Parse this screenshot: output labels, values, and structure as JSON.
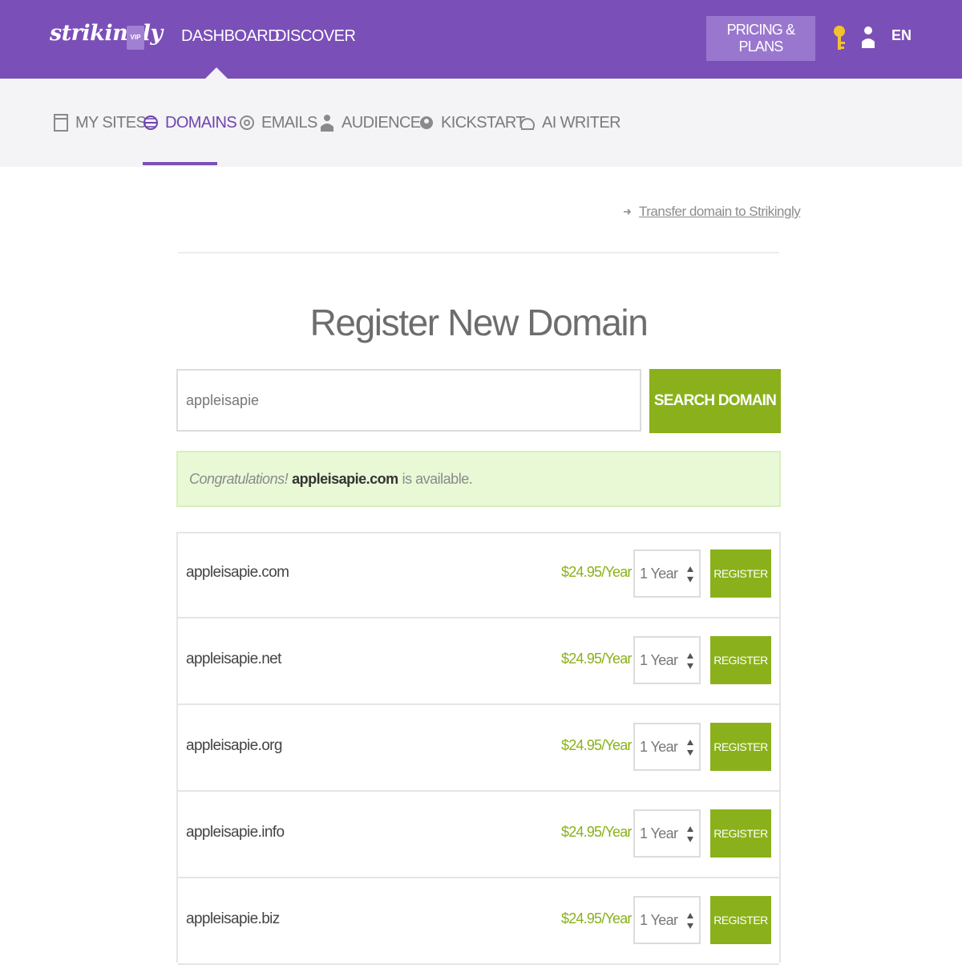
{
  "header": {
    "logo": "strikingly",
    "vip_badge": "VIP",
    "nav": [
      {
        "label": "DASHBOARD"
      },
      {
        "label": "DISCOVER"
      }
    ],
    "pricing_label": "PRICING & PLANS",
    "lang_label": "EN",
    "color": "#7b4fb8"
  },
  "subnav": {
    "items": [
      {
        "label": "MY SITES",
        "icon": "page-icon"
      },
      {
        "label": "DOMAINS",
        "icon": "globe-icon",
        "active": true
      },
      {
        "label": "EMAILS",
        "icon": "at-icon"
      },
      {
        "label": "AUDIENCE",
        "icon": "people-icon"
      },
      {
        "label": "KICKSTART",
        "icon": "rocket-icon"
      },
      {
        "label": "AI WRITER",
        "icon": "ai-writer-icon"
      }
    ]
  },
  "main": {
    "transfer_link": "Transfer domain to Strikingly",
    "heading": "Register New Domain",
    "search": {
      "value": "appleisapie",
      "button_label": "SEARCH DOMAIN"
    },
    "alert": {
      "prefix": "Congratulations!",
      "domain": "appleisapie.com",
      "suffix": "is available."
    },
    "domains": [
      {
        "name": "appleisapie.com",
        "price": "$24.95/Year",
        "term": "1 Year",
        "register_label": "REGISTER"
      },
      {
        "name": "appleisapie.net",
        "price": "$24.95/Year",
        "term": "1 Year",
        "register_label": "REGISTER"
      },
      {
        "name": "appleisapie.org",
        "price": "$24.95/Year",
        "term": "1 Year",
        "register_label": "REGISTER"
      },
      {
        "name": "appleisapie.info",
        "price": "$24.95/Year",
        "term": "1 Year",
        "register_label": "REGISTER"
      },
      {
        "name": "appleisapie.biz",
        "price": "$24.95/Year",
        "term": "1 Year",
        "register_label": "REGISTER"
      }
    ],
    "accent_color": "#8ab11b"
  }
}
